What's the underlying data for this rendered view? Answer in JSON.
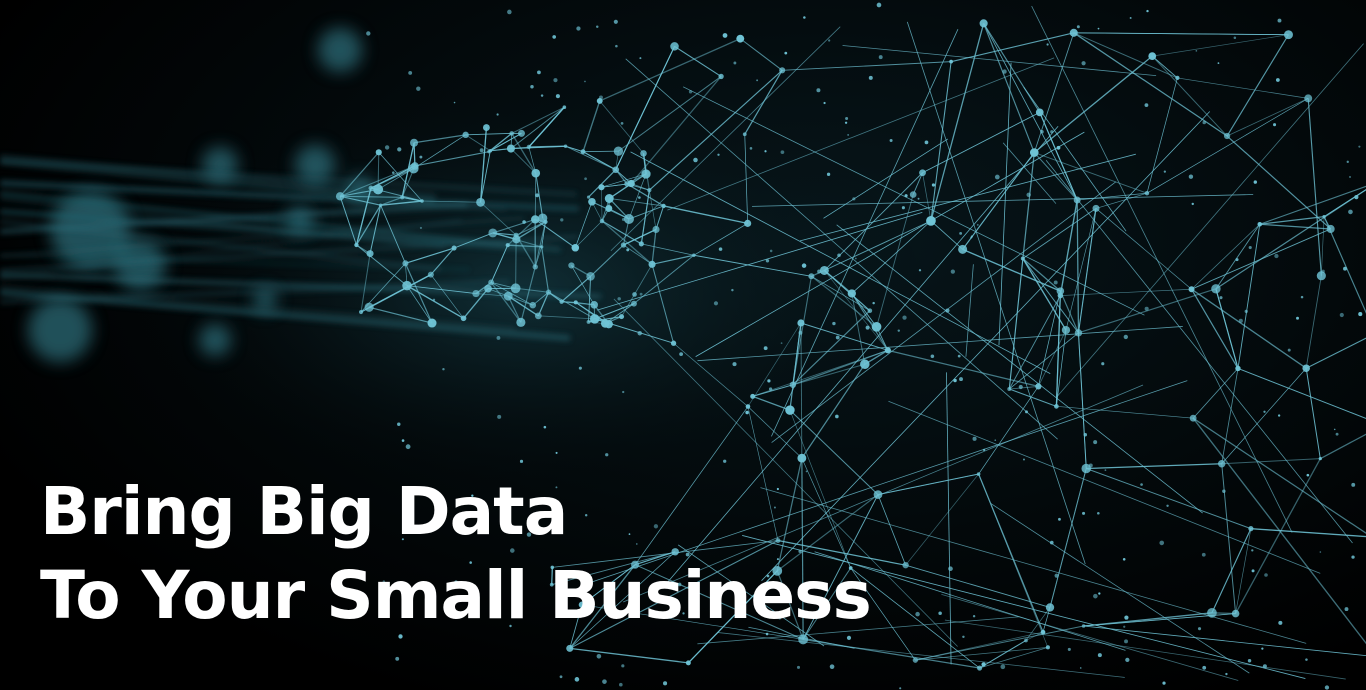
{
  "headline": {
    "line1": "Bring Big Data",
    "line2": "To Your Small Business"
  },
  "colors": {
    "background": "#000000",
    "network": "#6fc4d6",
    "text": "#ffffff"
  },
  "icons": {
    "background": "data-network-icon"
  }
}
